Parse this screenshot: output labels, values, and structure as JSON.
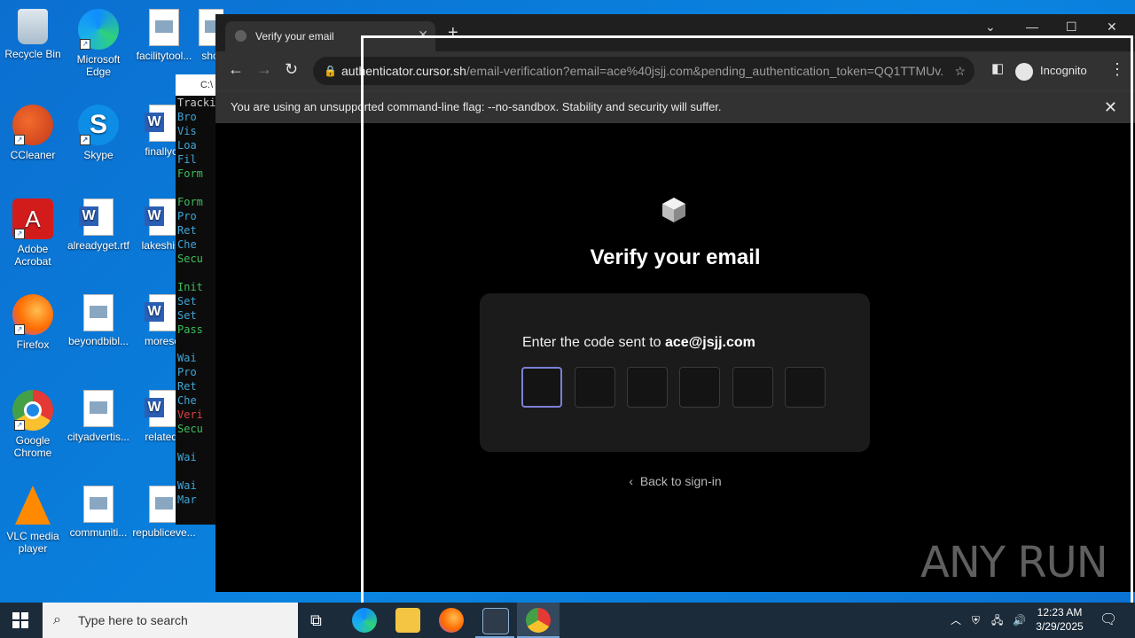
{
  "desktop": {
    "icons": [
      {
        "label": "Recycle Bin"
      },
      {
        "label": "Microsoft Edge"
      },
      {
        "label": "facilitytool..."
      },
      {
        "label": "sho"
      },
      {
        "label": "CCleaner"
      },
      {
        "label": "Skype"
      },
      {
        "label": "finallych"
      },
      {
        "label": "Adobe Acrobat"
      },
      {
        "label": "alreadyget.rtf"
      },
      {
        "label": "lakeshipp"
      },
      {
        "label": "Firefox"
      },
      {
        "label": "beyondbibl..."
      },
      {
        "label": "moresor"
      },
      {
        "label": "Google Chrome"
      },
      {
        "label": "cityadvertis..."
      },
      {
        "label": "relatedp"
      },
      {
        "label": "VLC media player"
      },
      {
        "label": "communiti..."
      },
      {
        "label": "republiceve..."
      }
    ]
  },
  "console": {
    "title": "C:\\",
    "lines": [
      "Tracki",
      " Bro",
      " Vis",
      " Loa",
      " Fil",
      " Form",
      "",
      " Form",
      " Pro",
      " Ret",
      " Che",
      " Secu",
      "",
      " Init",
      " Set",
      " Set",
      " Pass",
      "",
      " Wai",
      " Pro",
      " Ret",
      " Che",
      " Veri",
      " Secu",
      "",
      " Wai",
      "",
      " Wai",
      " Mar"
    ]
  },
  "browser": {
    "tab_title": "Verify your email",
    "url_host": "authenticator.cursor.sh",
    "url_rest": "/email-verification?email=ace%40jsjj.com&pending_authentication_token=QQ1TTMUv...",
    "incognito_label": "Incognito",
    "infobar_text": "You are using an unsupported command-line flag: --no-sandbox. Stability and security will suffer."
  },
  "page": {
    "heading": "Verify your email",
    "prompt_prefix": "Enter the code sent to ",
    "email": "ace@jsjj.com",
    "back_link": "Back to sign-in",
    "watermark": "ANY RUN"
  },
  "taskbar": {
    "search_placeholder": "Type here to search",
    "time": "12:23 AM",
    "date": "3/29/2025"
  },
  "colors": {
    "desktop": "#0a78d7",
    "otp_focus": "#7b80d6"
  }
}
